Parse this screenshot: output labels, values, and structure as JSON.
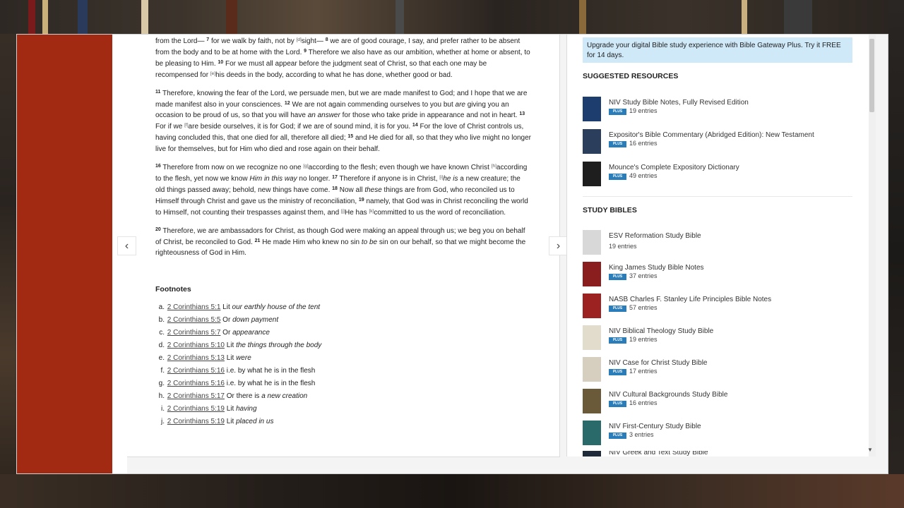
{
  "passage": {
    "p1": {
      "t1": "from the Lord— ",
      "v7": "7",
      "t2": " for we walk by faith, not by ",
      "fnd": "[d]",
      "t3": "sight— ",
      "v8": "8",
      "t4": " we are of good courage, I say, and prefer rather to be absent from the body and to be at home with the Lord. ",
      "v9": "9",
      "t5": " Therefore we also have as our ambition, whether at home or absent, to be pleasing to Him. ",
      "v10": "10",
      "t6": " For we must all appear before the judgment seat of Christ, so that each one may be recompensed for ",
      "fne": "[e]",
      "t7": "his deeds in the body, according to what he has done, whether good or bad."
    },
    "p2": {
      "v11": "11",
      "t1": " Therefore, knowing the fear of the Lord, we persuade men, but we are made manifest to God; and I hope that we are made manifest also in your consciences. ",
      "v12": "12",
      "t2": " We are not again commending ourselves to you but ",
      "i1": "are",
      "t3": " giving you an occasion to be proud of us, so that you will have ",
      "i2": "an answer",
      "t4": " for those who take pride in appearance and not in heart. ",
      "v13": "13",
      "t5": " For if we ",
      "fnf": "[f]",
      "t6": "are beside ourselves, it is for God; if we are of sound mind, it is for you. ",
      "v14": "14",
      "t7": " For the love of Christ controls us, having concluded this, that one died for all, therefore all died; ",
      "v15": "15",
      "t8": " and He died for all, so that they who live might no longer live for themselves, but for Him who died and rose again on their behalf."
    },
    "p3": {
      "v16": "16",
      "t1": " Therefore from now on we recognize no one ",
      "fng": "[g]",
      "t2": "according to the flesh; even though we have known Christ ",
      "fnh": "[h]",
      "t3": "according to the flesh, yet now we know ",
      "i1": "Him in this way",
      "t4": " no longer. ",
      "v17": "17",
      "t5": " Therefore if anyone is in Christ, ",
      "fni": "[i]",
      "i2": "he is",
      "t6": " a new creature; the old things passed away; behold, new things have come. ",
      "v18": "18",
      "t7": " Now all ",
      "i3": "these",
      "t8": " things are from God, who reconciled us to Himself through Christ and gave us the ministry of reconciliation, ",
      "v19": "19",
      "t9": " namely, that God was in Christ reconciling the world to Himself, not counting their trespasses against them, and ",
      "fnj": "[j]",
      "t10": "He has ",
      "fnk": "[k]",
      "t11": "committed to us the word of reconciliation."
    },
    "p4": {
      "v20": "20",
      "t1": " Therefore, we are ambassadors for Christ, as though God were making an appeal through us; we beg you on behalf of Christ, be reconciled to God. ",
      "v21": "21",
      "t2": " He made Him who knew no sin ",
      "i1": "to be",
      "t3": " sin on our behalf, so that we might become the righteousness of God in Him."
    }
  },
  "footnotes": {
    "heading": "Footnotes",
    "items": [
      {
        "letter": "a.",
        "ref": "2 Corinthians 5:1",
        "pre": "Lit ",
        "text": "our earthly house of the tent"
      },
      {
        "letter": "b.",
        "ref": "2 Corinthians 5:5",
        "pre": "Or ",
        "text": "down payment"
      },
      {
        "letter": "c.",
        "ref": "2 Corinthians 5:7",
        "pre": "Or ",
        "text": "appearance"
      },
      {
        "letter": "d.",
        "ref": "2 Corinthians 5:10",
        "pre": "Lit ",
        "text": "the things through the body"
      },
      {
        "letter": "e.",
        "ref": "2 Corinthians 5:13",
        "pre": "Lit ",
        "text": "were"
      },
      {
        "letter": "f.",
        "ref": "2 Corinthians 5:16",
        "pre": "i.e. by what he is in the flesh",
        "text": ""
      },
      {
        "letter": "g.",
        "ref": "2 Corinthians 5:16",
        "pre": "i.e. by what he is in the flesh",
        "text": ""
      },
      {
        "letter": "h.",
        "ref": "2 Corinthians 5:17",
        "pre": "Or there is ",
        "text": "a new creation"
      },
      {
        "letter": "i.",
        "ref": "2 Corinthians 5:19",
        "pre": "Lit ",
        "text": "having"
      },
      {
        "letter": "j.",
        "ref": "2 Corinthians 5:19",
        "pre": "Lit ",
        "text": "placed in us"
      }
    ]
  },
  "nav": {
    "prev_icon": "chevron-left-icon",
    "next_icon": "chevron-right-icon",
    "prev_glyph": "‹",
    "next_glyph": "›"
  },
  "sidebar": {
    "banner": "Upgrade your digital Bible study experience with Bible Gateway Plus. Try it FREE for 14 days.",
    "suggested_title": "SUGGESTED RESOURCES",
    "plus_label": "PLUS",
    "suggested": [
      {
        "title": "NIV Study Bible Notes, Fully Revised Edition",
        "count": "19 entries",
        "plus": true,
        "color": "#1d3d6e"
      },
      {
        "title": "Expositor's Bible Commentary (Abridged Edition): New Testament",
        "count": "16 entries",
        "plus": true,
        "color": "#2b3f5c"
      },
      {
        "title": "Mounce's Complete Expository Dictionary",
        "count": "49 entries",
        "plus": true,
        "color": "#1e1e1e"
      }
    ],
    "study_title": "STUDY BIBLES",
    "study": [
      {
        "title": "ESV Reformation Study Bible",
        "count": "19 entries",
        "plus": false,
        "color": "#d8d8d8"
      },
      {
        "title": "King James Study Bible Notes",
        "count": "37 entries",
        "plus": true,
        "color": "#8a1e1e"
      },
      {
        "title": "NASB Charles F. Stanley Life Principles Bible Notes",
        "count": "57 entries",
        "plus": true,
        "color": "#9c2222"
      },
      {
        "title": "NIV Biblical Theology Study Bible",
        "count": "19 entries",
        "plus": true,
        "color": "#e2dccc"
      },
      {
        "title": "NIV Case for Christ Study Bible",
        "count": "17 entries",
        "plus": true,
        "color": "#d6cfc0"
      },
      {
        "title": "NIV Cultural Backgrounds Study Bible",
        "count": "16 entries",
        "plus": true,
        "color": "#6a5a3a"
      },
      {
        "title": "NIV First-Century Study Bible",
        "count": "3 entries",
        "plus": true,
        "color": "#2a6a6a"
      }
    ],
    "cutoff": "NIV Greek and Text Study Bible"
  },
  "colors": {
    "red_bar": "#a22a12",
    "plus_badge": "#2a7db8",
    "banner": "#cfe9f9"
  }
}
